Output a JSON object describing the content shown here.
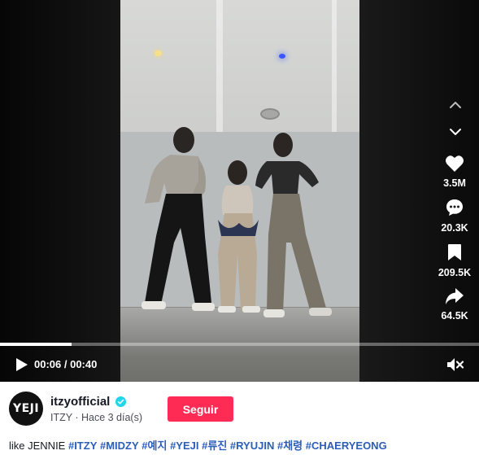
{
  "player": {
    "time_display": "00:06 / 00:40",
    "progress": 0.15,
    "side_actions": [
      {
        "icon": "heart-icon",
        "count": "3.5M"
      },
      {
        "icon": "comment-icon",
        "count": "20.3K"
      },
      {
        "icon": "bookmark-icon",
        "count": "209.5K"
      },
      {
        "icon": "share-icon",
        "count": "64.5K"
      }
    ]
  },
  "author": {
    "avatar_text": "YEJI",
    "username": "itzyofficial",
    "display_name": "ITZY",
    "separator": " · ",
    "posted": "Hace 3 día(s)",
    "follow_label": "Seguir"
  },
  "caption": {
    "text": "like JENNIE ",
    "hashtags": [
      "#ITZY",
      "#MIDZY",
      "#예지",
      "#YEJI",
      "#류진",
      "#RYUJIN",
      "#채령",
      "#CHAERYEONG"
    ]
  },
  "colors": {
    "follow": "#fe2c55",
    "hashtag": "#2b5db9",
    "verified": "#20d5ec"
  }
}
